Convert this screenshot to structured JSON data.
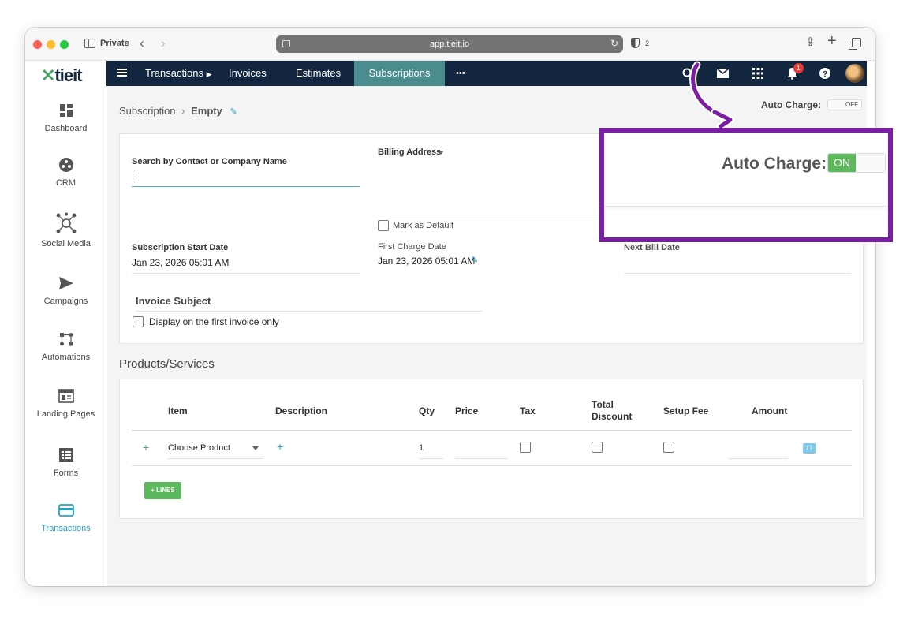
{
  "browser": {
    "private_label": "Private",
    "url": "app.tieit.io",
    "shield_count": "2"
  },
  "logo": {
    "text": "tieit"
  },
  "sidebar": {
    "items": [
      {
        "label": "Dashboard",
        "icon": "dashboard-icon"
      },
      {
        "label": "CRM",
        "icon": "crm-icon"
      },
      {
        "label": "Social Media",
        "icon": "social-media-icon"
      },
      {
        "label": "Campaigns",
        "icon": "send-icon"
      },
      {
        "label": "Automations",
        "icon": "automations-icon"
      },
      {
        "label": "Landing Pages",
        "icon": "landing-pages-icon"
      },
      {
        "label": "Forms",
        "icon": "forms-icon"
      },
      {
        "label": "Transactions",
        "icon": "credit-card-icon",
        "active": true
      }
    ]
  },
  "topnav": {
    "tabs": [
      "Transactions",
      "Invoices",
      "Estimates",
      "Subscriptions"
    ],
    "more": "•••",
    "active_tab": "Subscriptions",
    "notification_count": "1"
  },
  "breadcrumb": {
    "parent": "Subscription",
    "separator": "›",
    "current": "Empty"
  },
  "auto_charge": {
    "label": "Auto Charge:",
    "state": "OFF"
  },
  "callout": {
    "label": "Auto Charge:",
    "state": "ON"
  },
  "form": {
    "contact_label": "Search by Contact or Company Name",
    "contact_value": "",
    "billing_address_label": "Billing Address",
    "mark_default_label": "Mark as Default",
    "start_date_label": "Subscription Start Date",
    "start_date_value": "Jan 23, 2026 05:01 AM",
    "first_charge_label": "First Charge Date",
    "first_charge_value": "Jan 23, 2026 05:01 AM",
    "next_bill_label": "Next Bill Date",
    "invoice_subject_label": "Invoice Subject",
    "display_first_label": "Display on the first invoice only"
  },
  "products": {
    "title": "Products/Services",
    "columns": [
      "Item",
      "Description",
      "Qty",
      "Price",
      "Tax",
      "Total Discount",
      "Setup Fee",
      "Amount"
    ],
    "row": {
      "item": "Choose Product",
      "qty": "1"
    },
    "lines_button": "+ LINES",
    "code_icon_text": "{ }"
  },
  "colors": {
    "nav_bg": "#12263f",
    "active_tab": "#4b8c8f",
    "accent_blue": "#26a0c9",
    "green": "#5cb85c",
    "callout_purple": "#7a1fa2"
  }
}
